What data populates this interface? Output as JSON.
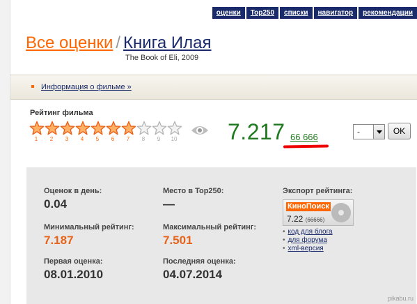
{
  "topnav": [
    "оценки",
    "Top250",
    "списки",
    "навигатор",
    "рекомендации"
  ],
  "title": {
    "all_ratings": "Все оценки",
    "separator": "/",
    "film": "Книга Илая",
    "subtitle": "The Book of Eli, 2009"
  },
  "info_link": "Информация о фильме »",
  "rating": {
    "label": "Рейтинг фильма",
    "stars": [
      "1",
      "2",
      "3",
      "4",
      "5",
      "6",
      "7",
      "8",
      "9",
      "10"
    ],
    "filled_stars": 7.217,
    "value": "7.217",
    "votes": "66 666",
    "select_value": "-",
    "ok_label": "OK"
  },
  "colors": {
    "accent": "#ff6600",
    "rating_green": "#1f7a1f",
    "nav": "#1a2b6b",
    "highlight": "#e00000"
  },
  "stats": {
    "per_day_label": "Оценок в день:",
    "per_day_value": "0.04",
    "top250_label": "Место в Top250:",
    "top250_value": "—",
    "min_label": "Минимальный рейтинг:",
    "min_value": "7.187",
    "max_label": "Максимальный рейтинг:",
    "max_value": "7.501",
    "first_label": "Первая оценка:",
    "first_value": "08.01.2010",
    "last_label": "Последняя оценка:",
    "last_value": "04.07.2014"
  },
  "export": {
    "label": "Экспорт рейтинга:",
    "logo": "КиноПоиск",
    "value": "7.22",
    "votes": "(66666)",
    "links": [
      "код для блога",
      "для форума",
      "xml-версия"
    ]
  },
  "watermark": "pikabu.ru"
}
